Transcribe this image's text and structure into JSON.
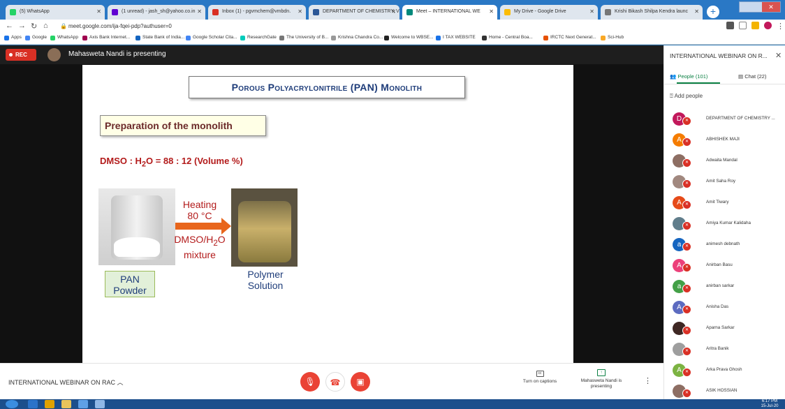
{
  "browser": {
    "tabs": [
      {
        "label": "(5) WhatsApp",
        "color": "#25d366"
      },
      {
        "label": "(1 unread) - jash_sh@yahoo.co.in",
        "color": "#6001d2"
      },
      {
        "label": "Inbox (1) - pgvmchem@vmbdn.",
        "color": "#d93025"
      },
      {
        "label": "DEPARTMENT OF CHEMISTRY, V",
        "color": "#2b5797"
      },
      {
        "label": "Meet – INTERNATIONAL WE",
        "color": "#00897b"
      },
      {
        "label": "My Drive - Google Drive",
        "color": "#fbbc04"
      },
      {
        "label": "Krishi Bikash Shilpa Kendra launc",
        "color": "#777777"
      }
    ],
    "address": "meet.google.com/ija-fqei-pdp?authuser=0",
    "bookmarks": [
      "Apps",
      "Google",
      "WhatsApp",
      "Axis Bank Internet...",
      "State Bank of India...",
      "Google Scholar Cita...",
      "ResearchGate",
      "The University of B...",
      "Krishna Chandra Co...",
      "Welcome to WBSE...",
      "I TAX WEBSITE",
      "Home - Central Boa...",
      "IRCTC Next Generat...",
      "Sci-Hub"
    ]
  },
  "meet": {
    "rec_label": "REC",
    "presenting_text": "Mahasweta Nandi is presenting",
    "meeting_title": "INTERNATIONAL WEBINAR ON RAC",
    "captions_label": "Turn on captions",
    "presenting_button": "Mahasweta Nandi is presenting"
  },
  "slide": {
    "title": "Porous Polyacrylonitrile (PAN) Monolith",
    "subtitle": "Preparation of the monolith",
    "equation_prefix": "DMSO : H",
    "equation_sub": "2",
    "equation_suffix": "O = 88 : 12 (Volume %)",
    "heating_line1": "Heating",
    "heating_line2": "80 °C",
    "mixture_prefix": "DMSO/H",
    "mixture_sub": "2",
    "mixture_suffix": "O",
    "mixture_line2": "mixture",
    "pan_line1": "PAN",
    "pan_line2": "Powder",
    "poly_line1": "Polymer",
    "poly_line2": "Solution"
  },
  "sidepanel": {
    "title": "INTERNATIONAL WEBINAR ON R...",
    "people_tab": "People (101)",
    "chat_tab": "Chat (22)",
    "add_people": "Add people",
    "participants": [
      {
        "name": "DEPARTMENT OF CHEMISTRY ...",
        "initial": "D",
        "color": "#c2185b"
      },
      {
        "name": "ABHISHEK MAJI",
        "initial": "A",
        "color": "#f57c00"
      },
      {
        "name": "Adwaita Mandal",
        "initial": "",
        "color": "#8d6e63"
      },
      {
        "name": "Amit Saha Roy",
        "initial": "",
        "color": "#a1887f"
      },
      {
        "name": "Amit Tiwary",
        "initial": "A",
        "color": "#e64a19"
      },
      {
        "name": "Amiya Kumar Kalidaha",
        "initial": "",
        "color": "#607d8b"
      },
      {
        "name": "animesh debnath",
        "initial": "a",
        "color": "#1565c0"
      },
      {
        "name": "Anirban Basu",
        "initial": "A",
        "color": "#ec407a"
      },
      {
        "name": "anirban sarkar",
        "initial": "a",
        "color": "#43a047"
      },
      {
        "name": "Anisha Das",
        "initial": "A",
        "color": "#5c6bc0"
      },
      {
        "name": "Aparna Sarkar",
        "initial": "",
        "color": "#3e2723"
      },
      {
        "name": "Aritra Banik",
        "initial": "",
        "color": "#9e9e9e"
      },
      {
        "name": "Arka Prava Ghosh",
        "initial": "A",
        "color": "#7cb342"
      },
      {
        "name": "ASIK HOSSIAN",
        "initial": "",
        "color": "#8d6e63"
      }
    ]
  },
  "taskbar": {
    "time": "6:17 PM",
    "date": "15-Jul-20"
  }
}
